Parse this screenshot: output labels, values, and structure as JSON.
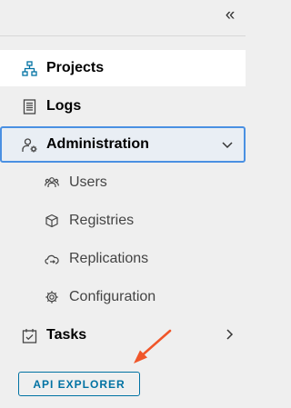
{
  "sidebar": {
    "collapse_glyph": "«",
    "items": [
      {
        "label": "Projects",
        "icon": "projects-icon"
      },
      {
        "label": "Logs",
        "icon": "logs-icon"
      },
      {
        "label": "Administration",
        "icon": "administration-icon",
        "expanded": true
      },
      {
        "label": "Tasks",
        "icon": "tasks-icon"
      }
    ],
    "admin_subitems": [
      {
        "label": "Users",
        "icon": "users-icon"
      },
      {
        "label": "Registries",
        "icon": "registries-icon"
      },
      {
        "label": "Replications",
        "icon": "replications-icon"
      },
      {
        "label": "Configuration",
        "icon": "configuration-icon"
      }
    ],
    "api_button_label": "API EXPLORER"
  },
  "colors": {
    "accent": "#0072a3",
    "selection_border": "#4a90e2",
    "annotation_arrow": "#f0562a"
  }
}
